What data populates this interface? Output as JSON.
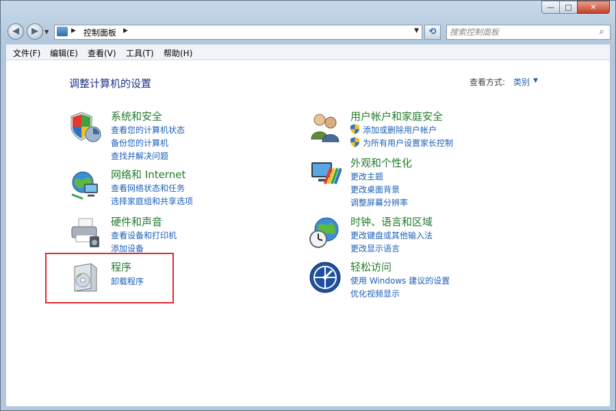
{
  "window_controls": {
    "minimize": "—",
    "maximize": "□",
    "close": "✕"
  },
  "nav": {
    "back": "◀",
    "forward": "▶"
  },
  "address": {
    "crumb": "控制面板"
  },
  "search": {
    "placeholder": "搜索控制面板"
  },
  "menu": [
    "文件(F)",
    "编辑(E)",
    "查看(V)",
    "工具(T)",
    "帮助(H)"
  ],
  "heading": "调整计算机的设置",
  "view_by": {
    "label": "查看方式:",
    "value": "类别"
  },
  "categories": [
    {
      "title": "系统和安全",
      "links": [
        "查看您的计算机状态",
        "备份您的计算机",
        "查找并解决问题"
      ]
    },
    {
      "title": "网络和 Internet",
      "links": [
        "查看网络状态和任务",
        "选择家庭组和共享选项"
      ]
    },
    {
      "title": "硬件和声音",
      "links": [
        "查看设备和打印机",
        "添加设备"
      ]
    },
    {
      "title": "程序",
      "links": [
        "卸载程序"
      ]
    },
    {
      "title": "用户帐户和家庭安全",
      "links": [
        "添加或删除用户帐户",
        "为所有用户设置家长控制"
      ]
    },
    {
      "title": "外观和个性化",
      "links": [
        "更改主题",
        "更改桌面背景",
        "调整屏幕分辨率"
      ]
    },
    {
      "title": "时钟、语言和区域",
      "links": [
        "更改键盘或其他输入法",
        "更改显示语言"
      ]
    },
    {
      "title": "轻松访问",
      "links": [
        "使用 Windows 建议的设置",
        "优化视频显示"
      ]
    }
  ],
  "colors": {
    "heading": "#1e3287",
    "category_title": "#227b2b",
    "link": "#1b5fb8",
    "highlight_box": "#e0282d"
  },
  "icons": [
    "shield-clock-icon",
    "network-globe-icon",
    "printer-icon",
    "software-box-icon",
    "users-icon",
    "monitor-palette-icon",
    "globe-clock-icon",
    "ease-of-access-icon"
  ]
}
